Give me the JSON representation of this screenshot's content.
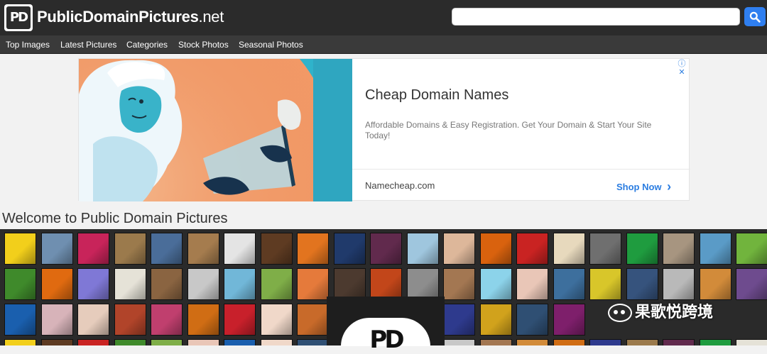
{
  "header": {
    "logo_mark": "PD",
    "site_name_bold": "PublicDomainPictures",
    "site_name_suffix": ".net",
    "search_placeholder": ""
  },
  "nav": {
    "items": [
      {
        "label": "Top Images"
      },
      {
        "label": "Latest Pictures"
      },
      {
        "label": "Categories"
      },
      {
        "label": "Stock Photos"
      },
      {
        "label": "Seasonal Photos"
      }
    ]
  },
  "ad": {
    "title": "Cheap Domain Names",
    "description": "Affordable Domains & Easy Registration. Get Your Domain & Start Your Site Today!",
    "brand": "Namecheap.com",
    "cta": "Shop Now",
    "cta_chevron": "›",
    "info_icons": "ⓘ ✕"
  },
  "main": {
    "heading": "Welcome to Public Domain Pictures"
  },
  "overlay": {
    "logo_mark": "PD"
  },
  "watermark": {
    "text": "果歌悦跨境"
  },
  "gallery": {
    "thumbnails": [
      {
        "subject": "yellow sunburst",
        "color": "#f2cf1b"
      },
      {
        "subject": "blue eye",
        "color": "#6f8fb0"
      },
      {
        "subject": "red flowers",
        "color": "#c8245a"
      },
      {
        "subject": "giraffe",
        "color": "#9b7a4c"
      },
      {
        "subject": "wind turbine",
        "color": "#4a6d99"
      },
      {
        "subject": "wood plank",
        "color": "#a57c4e"
      },
      {
        "subject": "santa woman",
        "color": "#e4e4e4"
      },
      {
        "subject": "coffee beans",
        "color": "#5e3b22"
      },
      {
        "subject": "orange ornament",
        "color": "#e2741f"
      },
      {
        "subject": "tower bridge",
        "color": "#203a6b"
      },
      {
        "subject": "berries",
        "color": "#612a4d"
      },
      {
        "subject": "ice",
        "color": "#9fc6de"
      },
      {
        "subject": "family",
        "color": "#ddb79a"
      },
      {
        "subject": "butterfly",
        "color": "#d9620e"
      },
      {
        "subject": "tulips",
        "color": "#c92322"
      },
      {
        "subject": "sheet music",
        "color": "#e7d9bd"
      },
      {
        "subject": "full moon",
        "color": "#6f6f6f"
      },
      {
        "subject": "green silhouette",
        "color": "#1f9c3f"
      },
      {
        "subject": "stone wall",
        "color": "#a79580"
      },
      {
        "subject": "beach bench",
        "color": "#5a9bc7"
      },
      {
        "subject": "green meadow",
        "color": "#71b43d"
      },
      {
        "subject": "grass",
        "color": "#3f8a2b"
      },
      {
        "subject": "pumpkin",
        "color": "#e06a10"
      },
      {
        "subject": "light bulb",
        "color": "#7f78d6"
      },
      {
        "subject": "colored pencils",
        "color": "#e5e2d7"
      },
      {
        "subject": "wood heart",
        "color": "#8a6441"
      },
      {
        "subject": "help key",
        "color": "#c8c8c8"
      },
      {
        "subject": "beach",
        "color": "#71b7d8"
      },
      {
        "subject": "deer",
        "color": "#7fae48"
      },
      {
        "subject": "peaches",
        "color": "#e57a3b"
      },
      {
        "subject": "woman headphones",
        "color": "#4c3a2f"
      },
      {
        "subject": "autumn tree",
        "color": "#c2461a"
      },
      {
        "subject": "elephant",
        "color": "#8d8d8d"
      },
      {
        "subject": "cathedral",
        "color": "#a37752"
      },
      {
        "subject": "cocktail",
        "color": "#8cd3ea"
      },
      {
        "subject": "woman flowers",
        "color": "#e9c6b7"
      },
      {
        "subject": "blue butterfly",
        "color": "#3d6f9d"
      },
      {
        "subject": "sunflower field",
        "color": "#d8c62a"
      },
      {
        "subject": "solar panels",
        "color": "#36537d"
      },
      {
        "subject": "einstein",
        "color": "#b9b9b9"
      },
      {
        "subject": "autumn river",
        "color": "#d28b3a"
      },
      {
        "subject": "purple bird",
        "color": "#6e4b8e"
      },
      {
        "subject": "blue fish",
        "color": "#1a5fae"
      },
      {
        "subject": "speech bubbles",
        "color": "#d7b3b9"
      },
      {
        "subject": "doctor child",
        "color": "#e6ccbc"
      },
      {
        "subject": "carousel",
        "color": "#b1442a"
      },
      {
        "subject": "sunset boat",
        "color": "#c03f6e"
      },
      {
        "subject": "autumn leaves",
        "color": "#d06d14"
      },
      {
        "subject": "christmas ornaments",
        "color": "#c8202b"
      },
      {
        "subject": "baby",
        "color": "#f0d8c9"
      },
      {
        "subject": "orange background",
        "color": "#c86a2a"
      },
      {
        "subject": "tree",
        "color": "#3d7a2f"
      },
      {
        "subject": "sleeping child",
        "color": "#5a3d2d"
      },
      {
        "subject": "red shoes",
        "color": "#b51822"
      },
      {
        "subject": "colorful lights",
        "color": "#2e3a8d"
      },
      {
        "subject": "yellow tree",
        "color": "#d1a21c"
      },
      {
        "subject": "mountain",
        "color": "#2f4f73"
      },
      {
        "subject": "fireworks",
        "color": "#7e1f6b"
      }
    ]
  }
}
